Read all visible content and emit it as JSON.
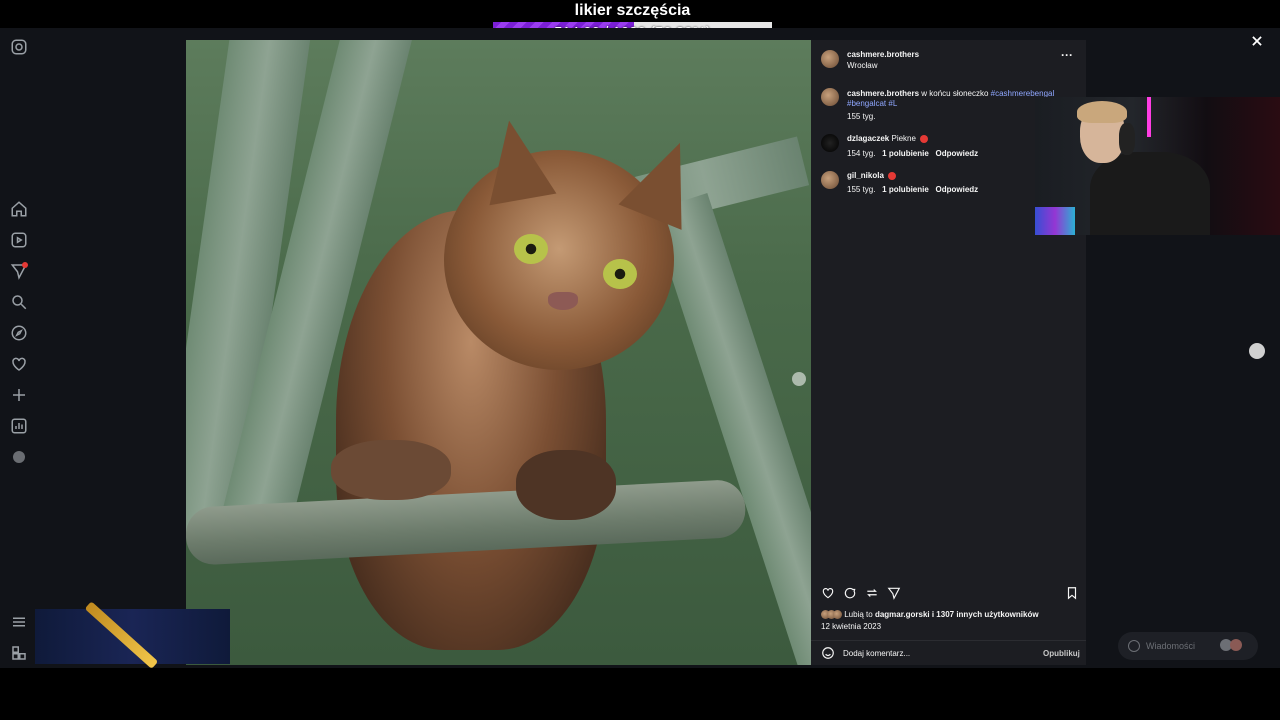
{
  "overlay": {
    "title": "likier szczęścia",
    "progress_text": "514.00 / 1020 (50.39%)",
    "progress_fraction": 0.5039
  },
  "post": {
    "author": "cashmere.brothers",
    "location": "Wrocław",
    "caption": {
      "author": "cashmere.brothers",
      "text": "w końcu słoneczko",
      "hashtag1": "#cashmerebengal",
      "hashtag2": "#bengalcat #L",
      "time": "155 tyg."
    },
    "comments": [
      {
        "user": "dzlagaczek",
        "text": "Piekne",
        "time": "154 tyg.",
        "likes": "1 polubienie",
        "reply": "Odpowiedz"
      },
      {
        "user": "gil_nikola",
        "text": "",
        "time": "155 tyg.",
        "likes": "1 polubienie",
        "reply": "Odpowiedz"
      }
    ],
    "likes_prefix": "Lubią to",
    "likes_user": "dagmar.gorski",
    "likes_rest": "i 1307 innych użytkowników",
    "date": "12 kwietnia 2023",
    "comment_placeholder": "Dodaj komentarz...",
    "publish_label": "Opublikuj"
  },
  "messages_label": "Wiadomości",
  "icons": {
    "sidebar": [
      "instagram-icon",
      "home-icon",
      "reels-icon",
      "messages-icon",
      "search-icon",
      "explore-icon",
      "heart-icon",
      "create-icon",
      "dashboard-icon",
      "profile-icon",
      "menu-icon",
      "threads-icon"
    ]
  }
}
